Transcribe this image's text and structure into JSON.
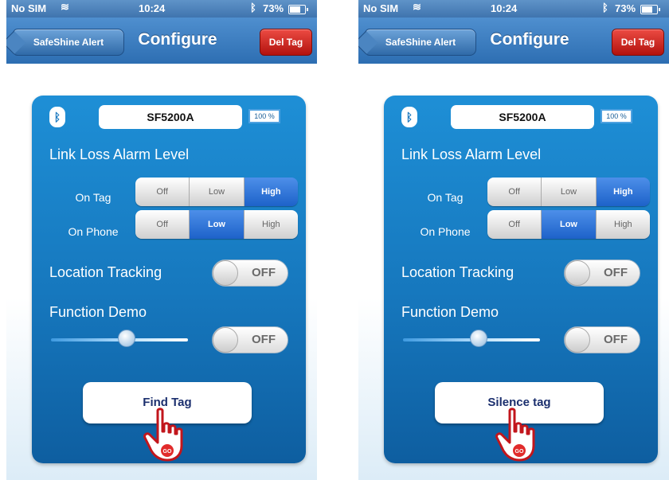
{
  "screens": [
    {
      "status": {
        "carrier": "No SIM",
        "wifi_icon": "wifi-icon",
        "time": "10:24",
        "bluetooth_icon": "bluetooth-icon",
        "battery": "73%",
        "battery_icon": "battery-icon"
      },
      "nav": {
        "back_label": "SafeShine Alert",
        "title": "Configure",
        "delete_label": "Del Tag"
      },
      "device": {
        "name": "SF5200A",
        "battery": "100 %"
      },
      "link_loss": {
        "title": "Link Loss Alarm Level",
        "on_tag": {
          "label": "On Tag",
          "options": [
            "Off",
            "Low",
            "High"
          ],
          "selected": "High"
        },
        "on_phone": {
          "label": "On Phone",
          "options": [
            "Off",
            "Low",
            "High"
          ],
          "selected": "Low"
        }
      },
      "location_tracking": {
        "label": "Location Tracking",
        "state": "OFF"
      },
      "function_demo": {
        "label": "Function Demo",
        "slider_value": 0.55,
        "state": "OFF"
      },
      "action_button": "Find Tag",
      "hand_text": "GO"
    },
    {
      "status": {
        "carrier": "No SIM",
        "wifi_icon": "wifi-icon",
        "time": "10:24",
        "bluetooth_icon": "bluetooth-icon",
        "battery": "73%",
        "battery_icon": "battery-icon"
      },
      "nav": {
        "back_label": "SafeShine Alert",
        "title": "Configure",
        "delete_label": "Del Tag"
      },
      "device": {
        "name": "SF5200A",
        "battery": "100 %"
      },
      "link_loss": {
        "title": "Link Loss Alarm Level",
        "on_tag": {
          "label": "On Tag",
          "options": [
            "Off",
            "Low",
            "High"
          ],
          "selected": "High"
        },
        "on_phone": {
          "label": "On Phone",
          "options": [
            "Off",
            "Low",
            "High"
          ],
          "selected": "Low"
        }
      },
      "location_tracking": {
        "label": "Location Tracking",
        "state": "OFF"
      },
      "function_demo": {
        "label": "Function Demo",
        "slider_value": 0.55,
        "state": "OFF"
      },
      "action_button": "Silence tag",
      "hand_text": "GO"
    }
  ]
}
